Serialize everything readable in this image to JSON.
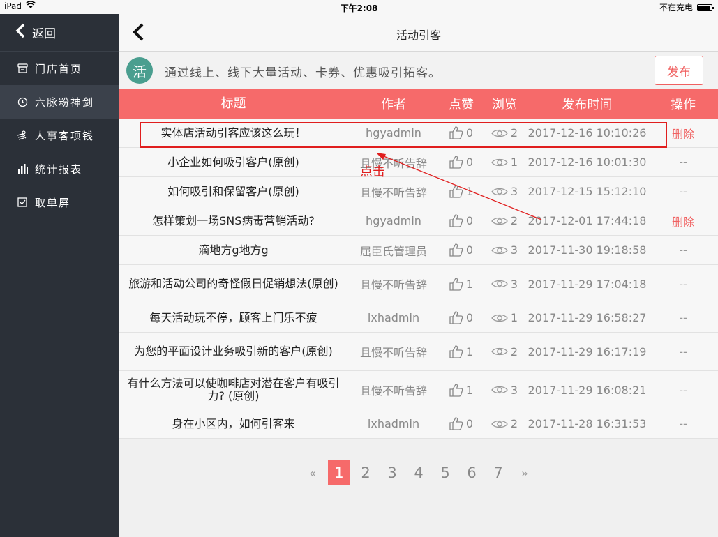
{
  "status_bar": {
    "device": "iPad",
    "time": "下午2:08",
    "charging": "不在充电"
  },
  "sidebar": {
    "back_label": "返回",
    "items": [
      {
        "label": "门店首页",
        "icon": "store-icon"
      },
      {
        "label": "六脉粉神剑",
        "icon": "clock-icon"
      },
      {
        "label": "人事客项钱",
        "icon": "people-icon"
      },
      {
        "label": "统计报表",
        "icon": "chart-icon"
      },
      {
        "label": "取单屏",
        "icon": "checkbox-icon"
      }
    ]
  },
  "header": {
    "title": "活动引客"
  },
  "banner": {
    "badge": "活",
    "text": "通过线上、线下大量活动、卡券、优惠吸引拓客。",
    "publish_label": "发布"
  },
  "table": {
    "headers": [
      "标题",
      "作者",
      "点赞",
      "浏览",
      "发布时间",
      "操作"
    ],
    "rows": [
      {
        "title": "实体店活动引客应该这么玩！",
        "author": "hgyadmin",
        "likes": "0",
        "views": "2",
        "time": "2017-12-16 10:10:26",
        "op": "删除"
      },
      {
        "title": "小企业如何吸引客户(原创)",
        "author": "且慢不听告辞",
        "likes": "0",
        "views": "1",
        "time": "2017-12-16 10:01:30",
        "op": "--"
      },
      {
        "title": "如何吸引和保留客户(原创)",
        "author": "且慢不听告辞",
        "likes": "1",
        "views": "3",
        "time": "2017-12-15 15:12:10",
        "op": "--"
      },
      {
        "title": "怎样策划一场SNS病毒营销活动?",
        "author": "hgyadmin",
        "likes": "0",
        "views": "2",
        "time": "2017-12-01 17:44:18",
        "op": "删除"
      },
      {
        "title": "滴地方g地方g",
        "author": "屈臣氏管理员",
        "likes": "0",
        "views": "3",
        "time": "2017-11-30 19:18:58",
        "op": "--"
      },
      {
        "title": "旅游和活动公司的奇怪假日促销想法(原创)",
        "author": "且慢不听告辞",
        "likes": "1",
        "views": "3",
        "time": "2017-11-29 17:04:18",
        "op": "--"
      },
      {
        "title": "每天活动玩不停，顾客上门乐不疲",
        "author": "lxhadmin",
        "likes": "0",
        "views": "1",
        "time": "2017-11-29 16:58:27",
        "op": "--"
      },
      {
        "title": "为您的平面设计业务吸引新的客户(原创)",
        "author": "且慢不听告辞",
        "likes": "1",
        "views": "2",
        "time": "2017-11-29 16:17:19",
        "op": "--"
      },
      {
        "title": "有什么方法可以使咖啡店对潜在客户有吸引力? (原创)",
        "author": "且慢不听告辞",
        "likes": "1",
        "views": "3",
        "time": "2017-11-29 16:08:21",
        "op": "--"
      },
      {
        "title": "身在小区内，如何引客来",
        "author": "lxhadmin",
        "likes": "0",
        "views": "2",
        "time": "2017-11-28 16:31:53",
        "op": "--"
      }
    ]
  },
  "pagination": {
    "prev": "«",
    "next": "»",
    "pages": [
      "1",
      "2",
      "3",
      "4",
      "5",
      "6",
      "7"
    ],
    "current": "1"
  },
  "annotation": {
    "text": "点击",
    "color": "#e01e1e"
  }
}
